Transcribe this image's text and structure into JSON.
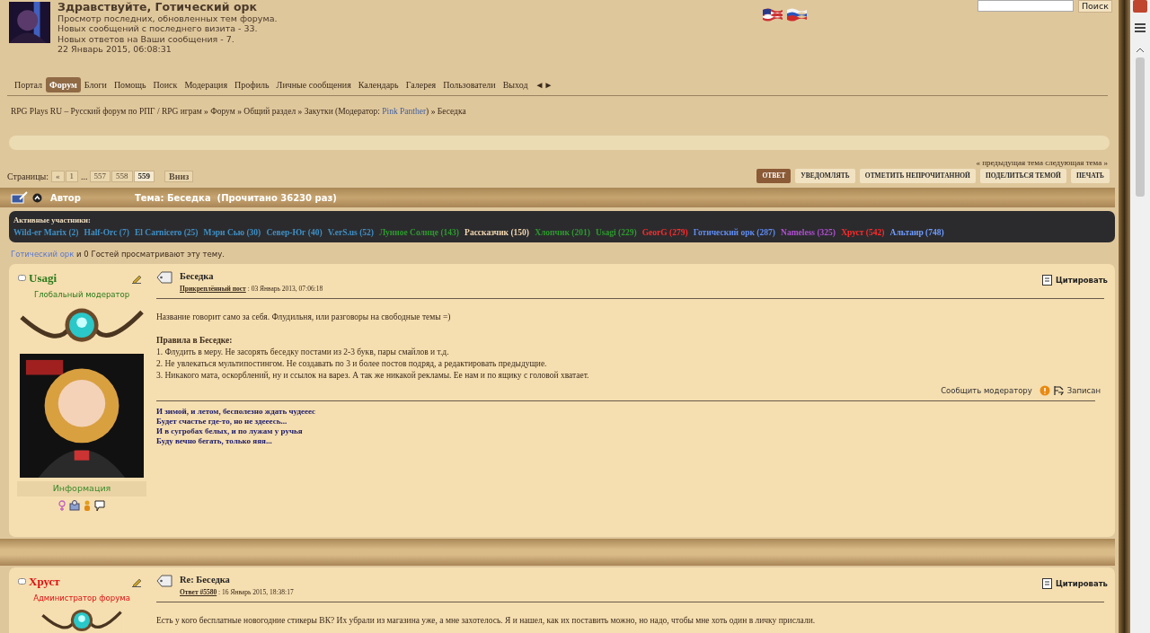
{
  "header": {
    "greeting": "Здравствуйте, Готический орк",
    "lines": [
      "Просмотр последних, обновленных тем форума.",
      "Новых сообщений с последнего визита - 33.",
      "Новых ответов на Ваши сообщения - 7.",
      "22 Январь 2015, 06:08:31"
    ]
  },
  "search": {
    "button": "Поиск"
  },
  "menu": [
    {
      "label": "Портал",
      "selected": false
    },
    {
      "label": "Форум",
      "selected": true
    },
    {
      "label": "Блоги",
      "selected": false
    },
    {
      "label": "Помощь",
      "selected": false
    },
    {
      "label": "Поиск",
      "selected": false
    },
    {
      "label": "Модерация",
      "selected": false
    },
    {
      "label": "Профиль",
      "selected": false
    },
    {
      "label": "Личные сообщения",
      "selected": false
    },
    {
      "label": "Календарь",
      "selected": false
    },
    {
      "label": "Галерея",
      "selected": false
    },
    {
      "label": "Пользователи",
      "selected": false
    },
    {
      "label": "Выход",
      "selected": false
    },
    {
      "label": "◄►",
      "selected": false
    }
  ],
  "breadcrumb": [
    {
      "text": "RPG Plays RU – Русский форум по РПГ / RPG играм",
      "separator": "»"
    },
    {
      "text": "Форум",
      "separator": "»"
    },
    {
      "text": "Общий раздел",
      "separator": "»"
    },
    {
      "text": "Закутки (Модератор:",
      "moderator": "Pink Panther",
      "close": ")",
      "separator": "»"
    },
    {
      "text": "Беседка"
    }
  ],
  "topic_nav": {
    "prev": "« предыдущая тема",
    "next": "следующая тема »"
  },
  "pagination": {
    "label": "Страницы:",
    "pages": [
      {
        "kind": "page",
        "label": "«",
        "selected": false
      },
      {
        "kind": "page",
        "label": "1",
        "selected": false
      },
      {
        "kind": "ellipsis",
        "label": "..."
      },
      {
        "kind": "page",
        "label": "557",
        "selected": false
      },
      {
        "kind": "page",
        "label": "558",
        "selected": false
      },
      {
        "kind": "page",
        "label": "559",
        "selected": true
      }
    ],
    "down": "Вниз"
  },
  "actions": [
    {
      "label": "ОТВЕТ",
      "primary": true
    },
    {
      "label": "УВЕДОМЛЯТЬ",
      "primary": false
    },
    {
      "label": "ОТМЕТИТЬ НЕПРОЧИТАННОЙ",
      "primary": false
    },
    {
      "label": "ПОДЕЛИТЬСЯ ТЕМОЙ",
      "primary": false
    },
    {
      "label": "ПЕЧАТЬ",
      "primary": false
    }
  ],
  "topic_header": {
    "author": "Автор",
    "topic": "Тема: Беседка  (Прочитано 36230 раз)"
  },
  "active": {
    "title": "Активные участники:",
    "members": [
      {
        "name": "Wild-er Marix (2)",
        "color": "#3f8fc4"
      },
      {
        "name": "Half-Orc (7)",
        "color": "#3f8fc4"
      },
      {
        "name": "El Carnicero (25)",
        "color": "#3f8fc4"
      },
      {
        "name": "Мэри Сью (30)",
        "color": "#3f8fc4"
      },
      {
        "name": "Север-Юг (40)",
        "color": "#3f8fc4"
      },
      {
        "name": "V.erS.us (52)",
        "color": "#3f8fc4"
      },
      {
        "name": "Лунное Солнце (143)",
        "color": "#2e9a2e"
      },
      {
        "name": "Рассказчик (150)",
        "color": "#f2d7b0"
      },
      {
        "name": "Хлопчик (201)",
        "color": "#2e9a2e"
      },
      {
        "name": "Usagi (229)",
        "color": "#2e9a2e"
      },
      {
        "name": "GeorG (279)",
        "color": "#ff2a2a"
      },
      {
        "name": "Готический орк (287)",
        "color": "#5f8cf0"
      },
      {
        "name": "Nameless (325)",
        "color": "#b04fd0"
      },
      {
        "name": "Хруст (542)",
        "color": "#ff2a2a"
      },
      {
        "name": "Альтаир (748)",
        "color": "#6f9cff"
      }
    ]
  },
  "viewers": {
    "user": "Готический орк",
    "text": "и 0 Гостей просматривают эту тему."
  },
  "posts": [
    {
      "author": "Usagi",
      "color": "#2a7a1a",
      "role": "Глобальный модератор",
      "title": "Беседка",
      "meta_label": "Прикреплённый пост",
      "meta_date": ": 03 Январь 2013, 07:06:18",
      "quote": "Цитировать",
      "body": [
        {
          "kind": "text",
          "text": "Название говорит само за себя. Флудильня, или разговоры на свободные темы =)"
        },
        {
          "kind": "heading",
          "text": "Правила в Беседке:"
        },
        {
          "kind": "text",
          "text": "1. Флудить в меру. Не засорять беседку постами из 2-3 букв, пары смайлов и т.д."
        },
        {
          "kind": "text",
          "text": "2. Не увлекаться мультипостингом. Не создавать по 3 и более постов подряд, а редактировать предыдущие."
        },
        {
          "kind": "text",
          "text": "3. Никакого мата, оскорблений, ну и ссылок на варез. А так же никакой рекламы. Ее нам и по ящику с головой хватает."
        }
      ],
      "report": "Сообщить модератору",
      "saved": "Записан",
      "signature": [
        "И зимой, и летом, бесполезно ждать чудееес",
        "Будет счастье где-то, но не здееесь...",
        "И в сугробах белых, и по лужам у ручья",
        "Буду вечно бегать, только яяя..."
      ],
      "info": "Информация"
    },
    {
      "author": "Хруст",
      "color": "#e01010",
      "role": "Администратор форума",
      "title": "Re: Беседка",
      "meta_label": "Ответ #5580",
      "meta_date": ": 16 Январь 2015, 18:38:17",
      "quote": "Цитировать",
      "body": [
        {
          "kind": "text",
          "text": "Есть у кого бесплатные новогодние стикеры ВК? Их убрали из магазина уже, а мне захотелось. Я и нашел, как их поставить можно, но надо, чтобы мне хоть один в личку прислали."
        }
      ]
    }
  ]
}
